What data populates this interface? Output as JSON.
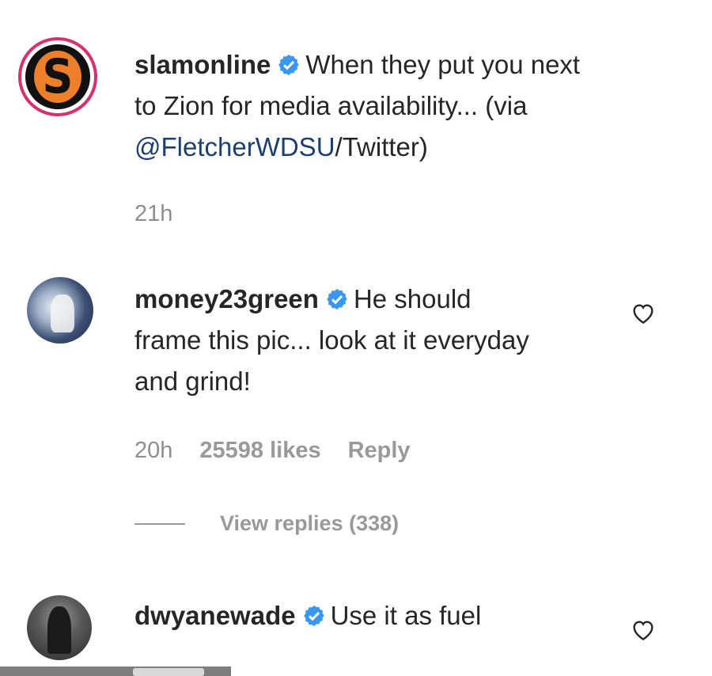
{
  "caption": {
    "username": "slamonline",
    "text_line1": "When they put you next",
    "text_line2": "to Zion for media availability... (via",
    "mention": "@FletcherWDSU",
    "text_line3_rest": "/Twitter)",
    "time": "21h",
    "avatar_letter": "S"
  },
  "comments": [
    {
      "username": "money23green",
      "text_line1": "He should",
      "text_line2": "frame this pic... look at it everyday",
      "text_line3": "and grind!",
      "time": "20h",
      "likes": "25598 likes",
      "reply_label": "Reply",
      "view_replies": "View replies (338)"
    },
    {
      "username": "dwyanewade",
      "text_line1": "Use it as fuel"
    }
  ],
  "colors": {
    "verified": "#3897f0",
    "link": "#1c3f71",
    "meta": "#8e8e8e"
  }
}
